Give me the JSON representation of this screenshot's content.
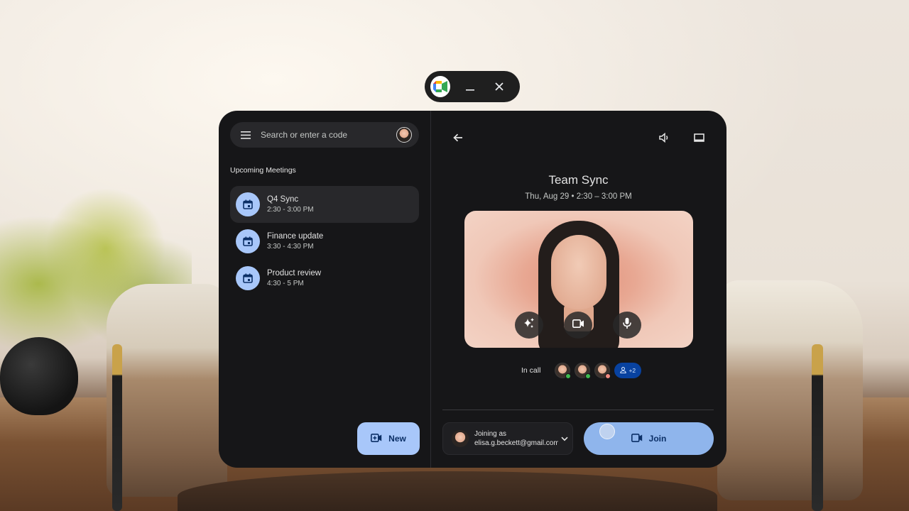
{
  "window_controls": {
    "app_icon": "google-meet-logo",
    "minimize_icon": "minimize-icon",
    "close_icon": "close-icon"
  },
  "sidebar": {
    "search_placeholder": "Search or enter a code",
    "section_title": "Upcoming Meetings",
    "meetings": [
      {
        "name": "Q4 Sync",
        "time": "2:30 - 3:00 PM",
        "active": true
      },
      {
        "name": "Finance update",
        "time": "3:30 - 4:30 PM",
        "active": false
      },
      {
        "name": "Product review",
        "time": "4:30 - 5 PM",
        "active": false
      }
    ],
    "new_button_label": "New"
  },
  "detail": {
    "title": "Team Sync",
    "subtitle": "Thu, Aug 29  •  2:30 – 3:00 PM",
    "in_call_label": "In call",
    "more_participants": "+2",
    "joining_as_label": "Joining as",
    "email": "elisa.g.beckett@gmail.com",
    "join_button_label": "Join"
  },
  "colors": {
    "accent": "#a8c7fa",
    "panel_bg": "#161618",
    "join_button": "#8fb5ec",
    "online_green": "#3fb950",
    "muted_red": "#f28b82"
  }
}
